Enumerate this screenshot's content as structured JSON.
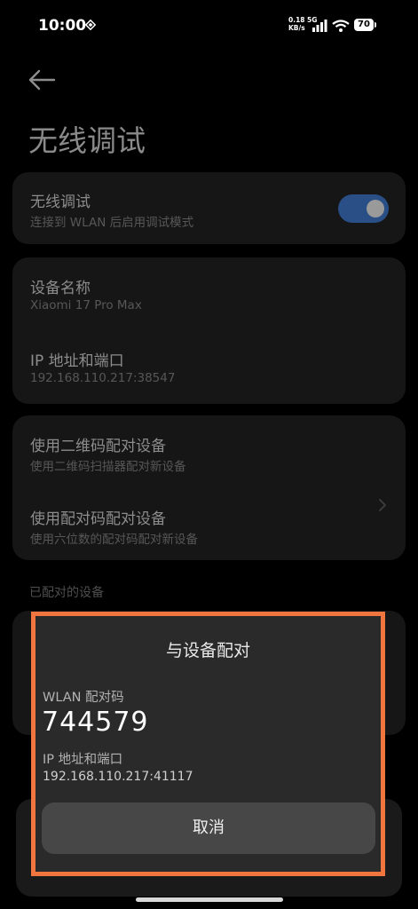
{
  "status_bar": {
    "time": "10:00",
    "net_speed_value": "0.18",
    "net_speed_unit": "KB/s",
    "network_type": "5G",
    "battery": "70"
  },
  "header": {
    "title": "无线调试"
  },
  "wireless_debug_card": {
    "title": "无线调试",
    "subtitle": "连接到 WLAN 后启用调试模式",
    "toggle_on": true
  },
  "device_card": {
    "name_title": "设备名称",
    "name_value": "Xiaomi 17 Pro Max",
    "ip_title": "IP 地址和端口",
    "ip_value": "192.168.110.217:38547"
  },
  "pairing_card": {
    "qr_title": "使用二维码配对设备",
    "qr_subtitle": "使用二维码扫描器配对新设备",
    "code_title": "使用配对码配对设备",
    "code_subtitle": "使用六位数的配对码配对新设备"
  },
  "paired_section": {
    "label": "已配对的设备"
  },
  "dialog": {
    "title": "与设备配对",
    "code_label": "WLAN 配对码",
    "code": "744579",
    "ip_label": "IP 地址和端口",
    "ip_value": "192.168.110.217:41117",
    "cancel_label": "取消"
  },
  "colors": {
    "highlight_outline": "#f0753f",
    "toggle_track": "#2a4f86",
    "dialog_bg": "#2a2a2a"
  }
}
